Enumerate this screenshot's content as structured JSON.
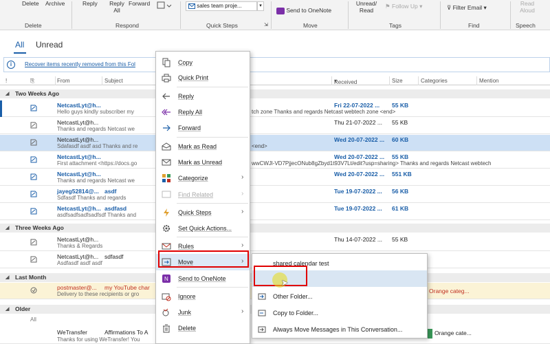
{
  "ribbon": {
    "buttons": {
      "delete": "Delete",
      "archive": "Archive",
      "reply": "Reply",
      "reply_all": "Reply All",
      "forward": "Forward",
      "quick_step_value": "sales team proje...",
      "send_to_onenote": "Send to OneNote",
      "unread_read": "Unread/ Read",
      "follow_up": "Follow Up",
      "filter_email": "Filter Email",
      "read_aloud": "Read Aloud"
    },
    "groups": {
      "delete": "Delete",
      "respond": "Respond",
      "quick_steps": "Quick Steps",
      "move": "Move",
      "tags": "Tags",
      "find": "Find",
      "speech": "Speech"
    }
  },
  "tabs": {
    "all": "All",
    "unread": "Unread"
  },
  "infobar": {
    "link": "Recover items recently removed from this Fol"
  },
  "columns": {
    "from": "From",
    "subject": "Subject",
    "received": "Received",
    "size": "Size",
    "categories": "Categories",
    "mention": "Mention"
  },
  "groups": {
    "two_weeks": "Two Weeks Ago",
    "three_weeks": "Three Weeks Ago",
    "last_month": "Last Month",
    "older": "Older"
  },
  "rows": [
    {
      "from": "NetcastLyt@h...",
      "preview": "Hello guys kindly subscriber my",
      "tail": "tch zone  Thanks and regards  Netcast webtech zone <end>",
      "received": "Fri 22-07-2022 ...",
      "size": "55 KB"
    },
    {
      "from": "NetcastLyt@h...",
      "preview": "Thanks and regards  Netcast we",
      "tail": "",
      "received": "Thu 21-07-2022 ...",
      "size": "55 KB"
    },
    {
      "from": "NetcastLyt@h...",
      "preview": "Sdafasdf asdf asd Thanks and re",
      "tail": "<end>",
      "received": "Wed 20-07-2022 ...",
      "size": "60 KB"
    },
    {
      "from": "NetcastLyt@h...",
      "preview": "First attachment  <https://docs.go",
      "tail": "wwCWJl-VD7PjjecONub8gZbyd1t93V7Lt/edit?usp=sharing>   Thanks and regards  Netcast webtech",
      "received": "Wed 20-07-2022 ...",
      "size": "55 KB"
    },
    {
      "from": "NetcastLyt@h...",
      "preview": "Thanks and regards  Netcast we",
      "tail": "",
      "received": "Wed 20-07-2022 ...",
      "size": "551 KB"
    },
    {
      "from": "jayeg52814@...",
      "subject": "asdf",
      "preview": "Sdfasdf  Thanks and regards",
      "tail": "",
      "received": "Tue 19-07-2022 ...",
      "size": "56 KB"
    },
    {
      "from": "NetcastLyt@h...",
      "subject": "asdfasd",
      "preview": "asdfsadfsadfsadfsdf  Thanks and",
      "tail": "",
      "received": "Tue 19-07-2022 ...",
      "size": "61 KB"
    },
    {
      "from": "NetcastLyt@h...",
      "preview": "Thanks & Regards",
      "tail": "",
      "received": "Thu 14-07-2022 ...",
      "size": "55 KB"
    },
    {
      "from": "NetcastLyt@h...",
      "subject": "sdfasdf",
      "preview": "Asdfasdf asdf asdf",
      "tail": "",
      "received": "",
      "size": ""
    },
    {
      "from": "postmaster@...",
      "subject": "my YouTube char",
      "preview": "Delivery to these recipients or gro",
      "tail": "",
      "received": "",
      "size": "",
      "category": "Orange categ..."
    },
    {
      "from": "WeTransfer",
      "subject": "Affirmations To A",
      "preview": "Thanks for using WeTransfer! You",
      "tail": "",
      "received": "",
      "size": "",
      "category": "Orange cate..."
    }
  ],
  "older_all": "All",
  "context_menu": [
    {
      "label": "Copy",
      "icon": "copy-icon"
    },
    {
      "label": "Quick Print",
      "icon": "print-icon"
    },
    {
      "label": "Reply",
      "icon": "reply-icon"
    },
    {
      "label": "Reply All",
      "icon": "reply-all-icon"
    },
    {
      "label": "Forward",
      "icon": "forward-icon"
    },
    {
      "label": "Mark as Read",
      "icon": "mark-read-icon"
    },
    {
      "label": "Mark as Unread",
      "icon": "mark-unread-icon"
    },
    {
      "label": "Categorize",
      "icon": "categorize-icon"
    },
    {
      "label": "Find Related",
      "icon": "find-related-icon"
    },
    {
      "label": "Quick Steps",
      "icon": "quick-steps-icon"
    },
    {
      "label": "Set Quick Actions...",
      "icon": "gear-icon"
    },
    {
      "label": "Rules",
      "icon": "rules-icon"
    },
    {
      "label": "Move",
      "icon": "move-icon"
    },
    {
      "label": "Send to OneNote",
      "icon": "onenote-icon"
    },
    {
      "label": "Ignore",
      "icon": "ignore-icon"
    },
    {
      "label": "Junk",
      "icon": "junk-icon"
    },
    {
      "label": "Delete",
      "icon": "delete-icon"
    }
  ],
  "submenu": {
    "shared_calendar": "shared calendar test",
    "other_folder": "Other Folder...",
    "copy_to_folder": "Copy to Folder...",
    "always_move": "Always Move Messages in This Conversation..."
  },
  "colors": {
    "accent": "#1a5ea8",
    "highlight_outline": "#e00000",
    "cursor_highlight": "#e6dc28"
  }
}
